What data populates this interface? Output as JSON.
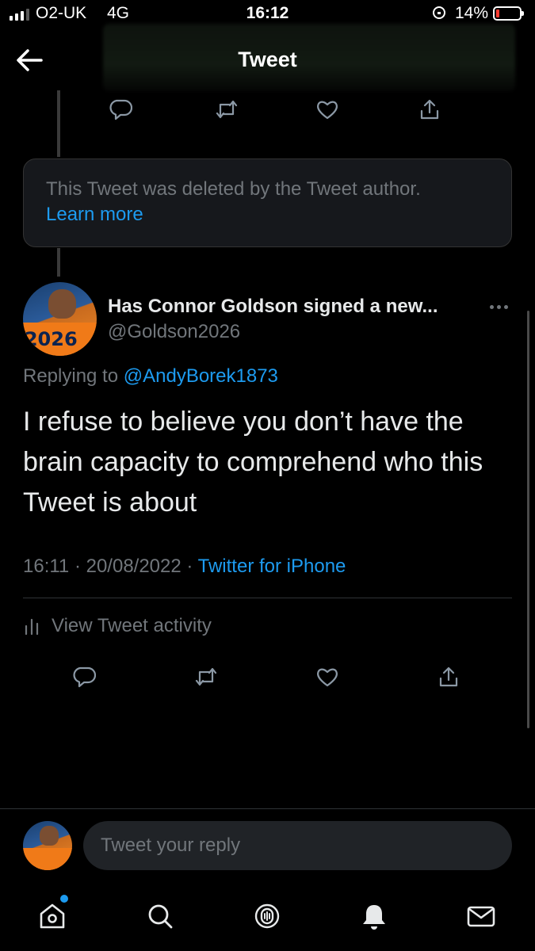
{
  "status_bar": {
    "carrier": "O2-UK",
    "network": "4G",
    "time": "16:12",
    "battery_percent": "14%",
    "battery_level": 0.14,
    "battery_color": "#ff3b30"
  },
  "header": {
    "title": "Tweet",
    "back_icon": "arrow-left-icon"
  },
  "parent_actions": {
    "icons": [
      "reply-icon",
      "retweet-icon",
      "like-icon",
      "share-icon"
    ]
  },
  "deleted_tweet": {
    "message": "This Tweet was deleted by the Tweet author.",
    "link_label": "Learn more"
  },
  "tweet": {
    "author_name": "Has Connor Goldson signed a new...",
    "author_handle": "@Goldson2026",
    "avatar_number": "2026",
    "replying_prefix": "Replying to ",
    "replying_to": "@AndyBorek1873",
    "text": "I refuse to believe you don’t have the brain capacity to comprehend who this Tweet is about",
    "time": "16:11",
    "date": "20/08/2022",
    "source": "Twitter for iPhone",
    "separator": " · "
  },
  "activity": {
    "label": "View Tweet activity"
  },
  "reply_bar": {
    "placeholder": "Tweet your reply"
  },
  "tab_bar": {
    "tabs": [
      "home-icon",
      "search-icon",
      "spaces-icon",
      "notifications-icon",
      "messages-icon"
    ]
  },
  "colors": {
    "background": "#000000",
    "accent": "#1d9bf0",
    "secondary_text": "#71767b",
    "primary_text": "#e7e9ea"
  }
}
